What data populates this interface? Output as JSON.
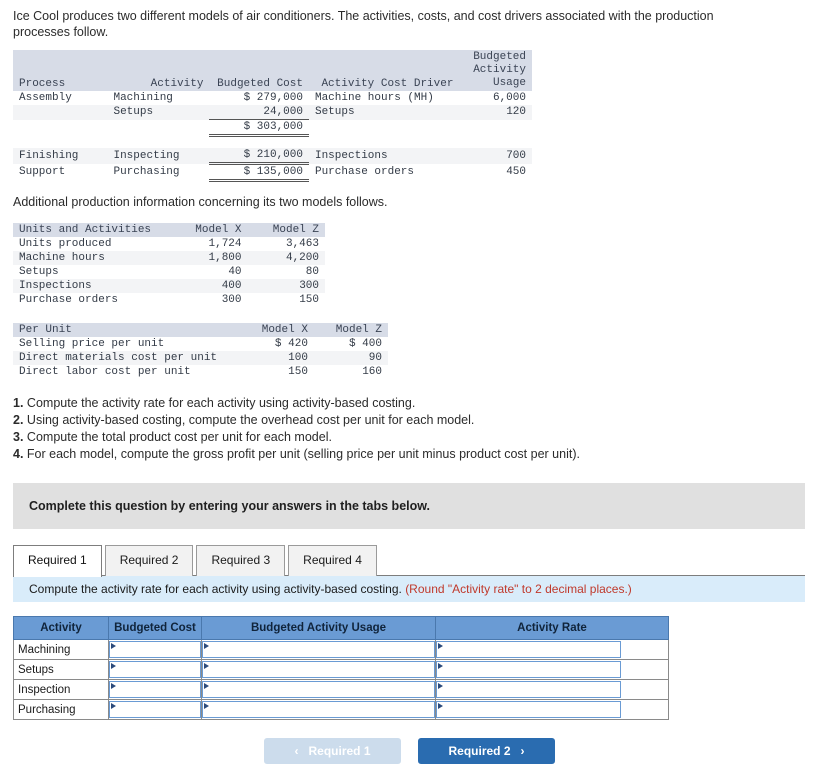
{
  "intro": {
    "paragraph1": "Ice Cool produces two different models of air conditioners. The activities, costs, and cost drivers associated with the production processes follow.",
    "paragraph2": "Additional production information concerning its two models follows."
  },
  "process_table": {
    "headers": [
      "Process",
      "Activity",
      "Budgeted Cost",
      "Activity Cost Driver",
      "Budgeted\nActivity\nUsage"
    ],
    "header_usage_line1": "Budgeted",
    "header_usage_line2": "Activity",
    "header_usage_line3": "Usage",
    "rows": [
      {
        "process": "Assembly",
        "activity": "Machining",
        "cost": "$ 279,000",
        "driver": "Machine hours (MH)",
        "usage": "6,000"
      },
      {
        "process": "",
        "activity": "Setups",
        "cost": "24,000",
        "driver": "Setups",
        "usage": "120"
      },
      {
        "process": "",
        "activity": "",
        "cost": "$ 303,000",
        "driver": "",
        "usage": ""
      },
      {
        "process": "Finishing",
        "activity": "Inspecting",
        "cost": "$ 210,000",
        "driver": "Inspections",
        "usage": "700"
      },
      {
        "process": "Support",
        "activity": "Purchasing",
        "cost": "$ 135,000",
        "driver": "Purchase orders",
        "usage": "450"
      }
    ]
  },
  "units_table": {
    "headers": [
      "Units and Activities",
      "Model X",
      "Model Z"
    ],
    "rows": [
      {
        "name": "Units produced",
        "model_x": "1,724",
        "model_z": "3,463"
      },
      {
        "name": "Machine hours",
        "model_x": "1,800",
        "model_z": "4,200"
      },
      {
        "name": "Setups",
        "model_x": "40",
        "model_z": "80"
      },
      {
        "name": "Inspections",
        "model_x": "400",
        "model_z": "300"
      },
      {
        "name": "Purchase orders",
        "model_x": "300",
        "model_z": "150"
      }
    ]
  },
  "perunit_table": {
    "headers": [
      "Per Unit",
      "Model X",
      "Model Z"
    ],
    "rows": [
      {
        "name": "Selling price per unit",
        "model_x": "$ 420",
        "model_z": "$ 400"
      },
      {
        "name": "Direct materials cost per unit",
        "model_x": "100",
        "model_z": "90"
      },
      {
        "name": "Direct labor cost per unit",
        "model_x": "150",
        "model_z": "160"
      }
    ]
  },
  "requirements": [
    {
      "num": "1.",
      "text": "Compute the activity rate for each activity using activity-based costing."
    },
    {
      "num": "2.",
      "text": "Using activity-based costing, compute the overhead cost per unit for each model."
    },
    {
      "num": "3.",
      "text": "Compute the total product cost per unit for each model."
    },
    {
      "num": "4.",
      "text": "For each model, compute the gross profit per unit (selling price per unit minus product cost per unit)."
    }
  ],
  "grey_banner": {
    "text": "Complete this question by entering your answers in the tabs below."
  },
  "tabs": [
    {
      "label": "Required 1",
      "active": true
    },
    {
      "label": "Required 2",
      "active": false
    },
    {
      "label": "Required 3",
      "active": false
    },
    {
      "label": "Required 4",
      "active": false
    }
  ],
  "blue_banner": {
    "main": "Compute the activity rate for each activity using activity-based costing.",
    "hint": "(Round \"Activity rate\" to 2 decimal places.)"
  },
  "answer_table": {
    "headers": [
      "Activity",
      "Budgeted Cost",
      "Budgeted Activity Usage",
      "Activity Rate"
    ],
    "rows": [
      {
        "activity": "Machining",
        "budgeted_cost": "",
        "budgeted_usage": "",
        "activity_rate": ""
      },
      {
        "activity": "Setups",
        "budgeted_cost": "",
        "budgeted_usage": "",
        "activity_rate": ""
      },
      {
        "activity": "Inspection",
        "budgeted_cost": "",
        "budgeted_usage": "",
        "activity_rate": ""
      },
      {
        "activity": "Purchasing",
        "budgeted_cost": "",
        "budgeted_usage": "",
        "activity_rate": ""
      }
    ]
  },
  "nav": {
    "prev_label": "Required 1",
    "next_label": "Required 2",
    "prev_chevron": "‹",
    "next_chevron": "›"
  },
  "colors": {
    "header_blue": "#6a9bd4",
    "banner_blue": "#d9ecfa",
    "banner_grey": "#e0e0e0",
    "button_blue": "#2a6cb0",
    "button_disabled": "#ccdcec",
    "hint_red": "#c0392b",
    "table_header_grey": "#d7dce7"
  }
}
